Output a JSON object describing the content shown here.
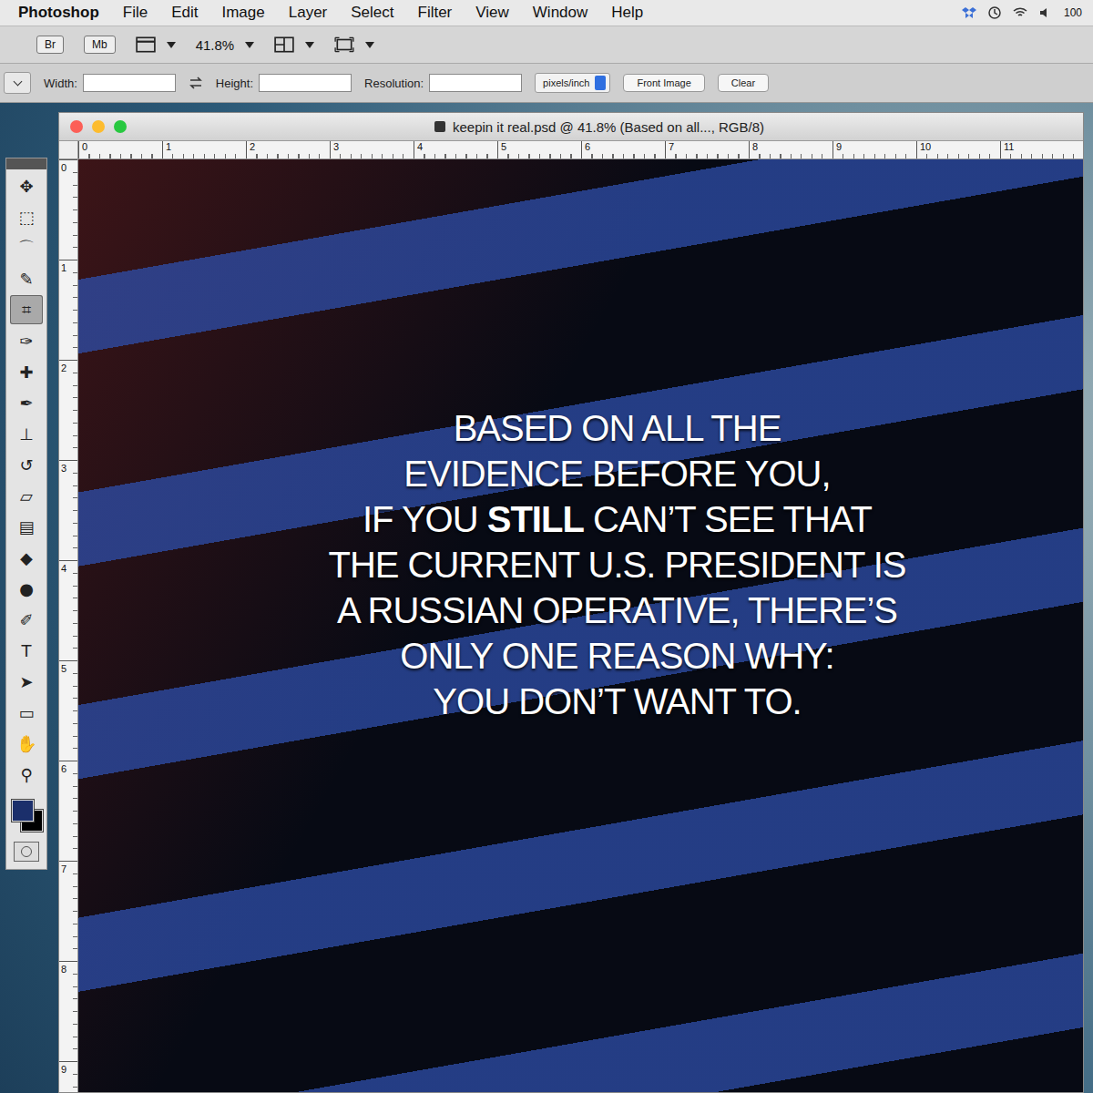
{
  "menubar": {
    "app": "Photoshop",
    "items": [
      "File",
      "Edit",
      "Image",
      "Layer",
      "Select",
      "Filter",
      "View",
      "Window",
      "Help"
    ],
    "battery": "100"
  },
  "options": {
    "bridge": "Br",
    "mini_bridge": "Mb",
    "zoom": "41.8%",
    "fields": [
      {
        "label": "Width:"
      },
      {
        "label": "Height:"
      },
      {
        "label": "Resolution:"
      }
    ],
    "unit": "pixels/inch",
    "buttons": [
      "Front Image",
      "Clear"
    ]
  },
  "tools": [
    {
      "icon": "✥",
      "selected": false
    },
    {
      "icon": "⬚",
      "selected": false
    },
    {
      "icon": "⌒",
      "selected": false
    },
    {
      "icon": "✎",
      "selected": false
    },
    {
      "icon": "⌗",
      "selected": true
    },
    {
      "icon": "✑",
      "selected": false
    },
    {
      "icon": "✚",
      "selected": false
    },
    {
      "icon": "✒",
      "selected": false
    },
    {
      "icon": "⊥",
      "selected": false
    },
    {
      "icon": "↺",
      "selected": false
    },
    {
      "icon": "▱",
      "selected": false
    },
    {
      "icon": "▤",
      "selected": false
    },
    {
      "icon": "◆",
      "selected": false
    },
    {
      "icon": "●",
      "selected": false
    },
    {
      "icon": "✐",
      "selected": false
    },
    {
      "icon": "T",
      "selected": false
    },
    {
      "icon": "➤",
      "selected": false
    },
    {
      "icon": "▭",
      "selected": false
    },
    {
      "icon": "✋",
      "selected": false
    },
    {
      "icon": "⚲",
      "selected": false
    }
  ],
  "swatches": [
    {
      "name": "foreground",
      "color": "#1b2f6b"
    },
    {
      "name": "background",
      "color": "#000000"
    }
  ],
  "document": {
    "title": "keepin it real.psd @ 41.8% (Based on all..., RGB/8)",
    "ruler_h": [
      "0",
      "1",
      "2",
      "3",
      "4",
      "5",
      "6",
      "7",
      "8",
      "9",
      "10",
      "11"
    ],
    "ruler_v": [
      "0",
      "1",
      "2",
      "3",
      "4",
      "5",
      "6",
      "7",
      "8",
      "9"
    ],
    "poster": [
      {
        "segments": [
          {
            "text": "BASED ON ALL THE",
            "bold": false
          }
        ]
      },
      {
        "segments": [
          {
            "text": "EVIDENCE BEFORE YOU,",
            "bold": false
          }
        ]
      },
      {
        "segments": [
          {
            "text": "IF YOU ",
            "bold": false
          },
          {
            "text": "STILL",
            "bold": true
          },
          {
            "text": " CAN’T SEE THAT",
            "bold": false
          }
        ]
      },
      {
        "segments": [
          {
            "text": "THE CURRENT U.S. PRESIDENT IS",
            "bold": false
          }
        ]
      },
      {
        "segments": [
          {
            "text": "A RUSSIAN OPERATIVE, THERE’S",
            "bold": false
          }
        ]
      },
      {
        "segments": [
          {
            "text": "ONLY ONE REASON WHY:",
            "bold": false
          }
        ]
      },
      {
        "segments": [
          {
            "text": "YOU DON’T WANT TO.",
            "bold": false
          }
        ]
      }
    ]
  }
}
